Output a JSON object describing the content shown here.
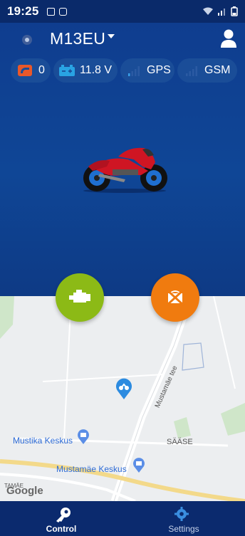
{
  "status_bar": {
    "time": "19:25"
  },
  "header": {
    "device_name": "M13EU"
  },
  "stats": {
    "alarm_count": "0",
    "voltage": "11.8 V",
    "gps_label": "GPS",
    "gsm_label": "GSM"
  },
  "colors": {
    "engine_button": "#8cba16",
    "alarm_button": "#f07b0f",
    "alarm_icon": "#e9582a",
    "voltage_icon": "#29a3e3",
    "bike_red": "#cf1523"
  },
  "icons": {
    "engine": "engine-icon",
    "alarm_off": "alarm-off-icon",
    "control": "key-icon",
    "settings": "gear-icon",
    "account": "account-icon"
  },
  "map": {
    "labels": {
      "street": "Mustamäe tee",
      "mustika": "Mustika Keskus",
      "mustamae": "Mustamäe Keskus",
      "saase": "SÄÄSE",
      "fragment": "TAMÄE"
    },
    "logo": "Google"
  },
  "nav": {
    "control": "Control",
    "settings": "Settings"
  }
}
